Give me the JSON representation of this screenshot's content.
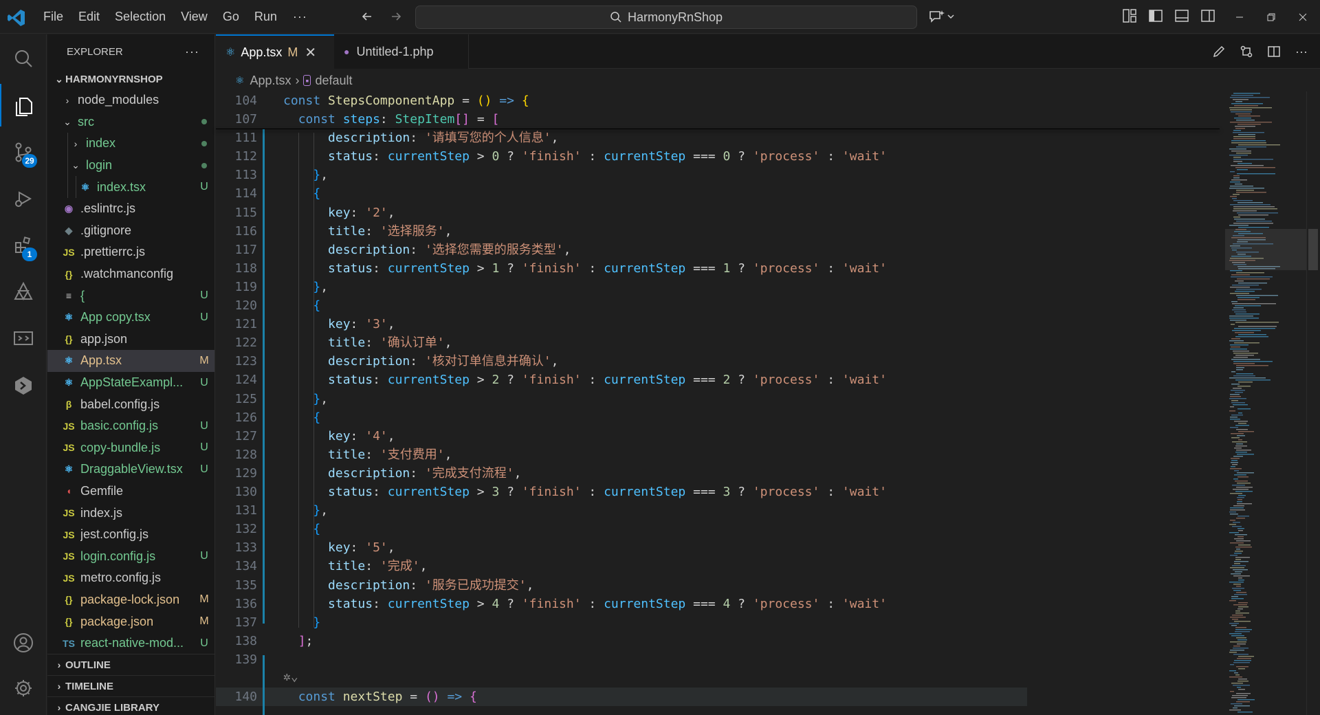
{
  "titlebar": {
    "menus": [
      "File",
      "Edit",
      "Selection",
      "View",
      "Go",
      "Run"
    ],
    "more": "···",
    "search_text": "HarmonyRnShop"
  },
  "activity": {
    "scm_badge": "29",
    "extensions_badge": "1"
  },
  "sidebar": {
    "title": "EXPLORER",
    "more": "···",
    "root": "HARMONYRNSHOP",
    "items": [
      {
        "name": "node_modules",
        "depth": 1,
        "kind": "folder",
        "open": false,
        "status": ""
      },
      {
        "name": "src",
        "depth": 1,
        "kind": "folder",
        "open": true,
        "status": "dot"
      },
      {
        "name": "index",
        "depth": 2,
        "kind": "folder",
        "open": false,
        "status": "dot"
      },
      {
        "name": "login",
        "depth": 2,
        "kind": "folder",
        "open": true,
        "status": "dot"
      },
      {
        "name": "index.tsx",
        "depth": 3,
        "kind": "react",
        "status": "U"
      },
      {
        "name": ".eslintrc.js",
        "depth": 1,
        "kind": "eslint",
        "status": ""
      },
      {
        "name": ".gitignore",
        "depth": 1,
        "kind": "git",
        "status": ""
      },
      {
        "name": ".prettierrc.js",
        "depth": 1,
        "kind": "js",
        "status": ""
      },
      {
        "name": ".watchmanconfig",
        "depth": 1,
        "kind": "json",
        "status": ""
      },
      {
        "name": "{",
        "depth": 1,
        "kind": "text",
        "status": "U"
      },
      {
        "name": "App copy.tsx",
        "depth": 1,
        "kind": "react",
        "status": "U"
      },
      {
        "name": "app.json",
        "depth": 1,
        "kind": "json",
        "status": ""
      },
      {
        "name": "App.tsx",
        "depth": 1,
        "kind": "react",
        "status": "M",
        "selected": true
      },
      {
        "name": "AppStateExampl...",
        "depth": 1,
        "kind": "react",
        "status": "U"
      },
      {
        "name": "babel.config.js",
        "depth": 1,
        "kind": "babel",
        "status": ""
      },
      {
        "name": "basic.config.js",
        "depth": 1,
        "kind": "js",
        "status": "U"
      },
      {
        "name": "copy-bundle.js",
        "depth": 1,
        "kind": "js",
        "status": "U"
      },
      {
        "name": "DraggableView.tsx",
        "depth": 1,
        "kind": "react",
        "status": "U"
      },
      {
        "name": "Gemfile",
        "depth": 1,
        "kind": "ruby",
        "status": ""
      },
      {
        "name": "index.js",
        "depth": 1,
        "kind": "js",
        "status": ""
      },
      {
        "name": "jest.config.js",
        "depth": 1,
        "kind": "js",
        "status": ""
      },
      {
        "name": "login.config.js",
        "depth": 1,
        "kind": "js",
        "status": "U"
      },
      {
        "name": "metro.config.js",
        "depth": 1,
        "kind": "js",
        "status": ""
      },
      {
        "name": "package-lock.json",
        "depth": 1,
        "kind": "json",
        "status": "M"
      },
      {
        "name": "package.json",
        "depth": 1,
        "kind": "json",
        "status": "M"
      },
      {
        "name": "react-native-mod...",
        "depth": 1,
        "kind": "ts",
        "status": "U"
      }
    ],
    "sections": [
      "OUTLINE",
      "TIMELINE",
      "CANGJIE LIBRARY"
    ]
  },
  "tabs": [
    {
      "label": "App.tsx",
      "status": "M",
      "active": true
    },
    {
      "label": "Untitled-1.php",
      "active": false
    }
  ],
  "breadcrumb": [
    "App.tsx",
    "default"
  ],
  "code": {
    "sticky": [
      {
        "n": "104",
        "tokens": [
          [
            "kw",
            "const "
          ],
          [
            "fn",
            "StepsComponentApp"
          ],
          [
            "pun",
            " = "
          ],
          [
            "br3",
            "()"
          ],
          [
            "kw",
            " => "
          ],
          [
            "br3",
            "{"
          ]
        ]
      },
      {
        "n": "107",
        "tokens": [
          [
            "pun",
            "  "
          ],
          [
            "kw",
            "const "
          ],
          [
            "var",
            "steps"
          ],
          [
            "pun",
            ": "
          ],
          [
            "type",
            "StepItem"
          ],
          [
            "br1",
            "[]"
          ],
          [
            "pun",
            " = "
          ],
          [
            "br1",
            "["
          ]
        ]
      }
    ],
    "lines": [
      {
        "n": "111",
        "tokens": [
          [
            "pun",
            "      "
          ],
          [
            "prop",
            "description"
          ],
          [
            "pun",
            ": "
          ],
          [
            "str",
            "'请填写您的个人信息'"
          ],
          [
            "pun",
            ","
          ]
        ]
      },
      {
        "n": "112",
        "tokens": [
          [
            "pun",
            "      "
          ],
          [
            "prop",
            "status"
          ],
          [
            "pun",
            ": "
          ],
          [
            "var",
            "currentStep"
          ],
          [
            "pun",
            " > "
          ],
          [
            "num",
            "0"
          ],
          [
            "pun",
            " ? "
          ],
          [
            "str",
            "'finish'"
          ],
          [
            "pun",
            " : "
          ],
          [
            "var",
            "currentStep"
          ],
          [
            "pun",
            " === "
          ],
          [
            "num",
            "0"
          ],
          [
            "pun",
            " ? "
          ],
          [
            "str",
            "'process'"
          ],
          [
            "pun",
            " : "
          ],
          [
            "str",
            "'wait'"
          ]
        ]
      },
      {
        "n": "113",
        "tokens": [
          [
            "pun",
            "    "
          ],
          [
            "br2",
            "}"
          ],
          [
            "pun",
            ","
          ]
        ]
      },
      {
        "n": "114",
        "tokens": [
          [
            "pun",
            "    "
          ],
          [
            "br2",
            "{"
          ]
        ]
      },
      {
        "n": "115",
        "tokens": [
          [
            "pun",
            "      "
          ],
          [
            "prop",
            "key"
          ],
          [
            "pun",
            ": "
          ],
          [
            "str",
            "'2'"
          ],
          [
            "pun",
            ","
          ]
        ]
      },
      {
        "n": "116",
        "tokens": [
          [
            "pun",
            "      "
          ],
          [
            "prop",
            "title"
          ],
          [
            "pun",
            ": "
          ],
          [
            "str",
            "'选择服务'"
          ],
          [
            "pun",
            ","
          ]
        ]
      },
      {
        "n": "117",
        "tokens": [
          [
            "pun",
            "      "
          ],
          [
            "prop",
            "description"
          ],
          [
            "pun",
            ": "
          ],
          [
            "str",
            "'选择您需要的服务类型'"
          ],
          [
            "pun",
            ","
          ]
        ]
      },
      {
        "n": "118",
        "tokens": [
          [
            "pun",
            "      "
          ],
          [
            "prop",
            "status"
          ],
          [
            "pun",
            ": "
          ],
          [
            "var",
            "currentStep"
          ],
          [
            "pun",
            " > "
          ],
          [
            "num",
            "1"
          ],
          [
            "pun",
            " ? "
          ],
          [
            "str",
            "'finish'"
          ],
          [
            "pun",
            " : "
          ],
          [
            "var",
            "currentStep"
          ],
          [
            "pun",
            " === "
          ],
          [
            "num",
            "1"
          ],
          [
            "pun",
            " ? "
          ],
          [
            "str",
            "'process'"
          ],
          [
            "pun",
            " : "
          ],
          [
            "str",
            "'wait'"
          ]
        ]
      },
      {
        "n": "119",
        "tokens": [
          [
            "pun",
            "    "
          ],
          [
            "br2",
            "}"
          ],
          [
            "pun",
            ","
          ]
        ]
      },
      {
        "n": "120",
        "tokens": [
          [
            "pun",
            "    "
          ],
          [
            "br2",
            "{"
          ]
        ]
      },
      {
        "n": "121",
        "tokens": [
          [
            "pun",
            "      "
          ],
          [
            "prop",
            "key"
          ],
          [
            "pun",
            ": "
          ],
          [
            "str",
            "'3'"
          ],
          [
            "pun",
            ","
          ]
        ]
      },
      {
        "n": "122",
        "tokens": [
          [
            "pun",
            "      "
          ],
          [
            "prop",
            "title"
          ],
          [
            "pun",
            ": "
          ],
          [
            "str",
            "'确认订单'"
          ],
          [
            "pun",
            ","
          ]
        ]
      },
      {
        "n": "123",
        "tokens": [
          [
            "pun",
            "      "
          ],
          [
            "prop",
            "description"
          ],
          [
            "pun",
            ": "
          ],
          [
            "str",
            "'核对订单信息并确认'"
          ],
          [
            "pun",
            ","
          ]
        ]
      },
      {
        "n": "124",
        "tokens": [
          [
            "pun",
            "      "
          ],
          [
            "prop",
            "status"
          ],
          [
            "pun",
            ": "
          ],
          [
            "var",
            "currentStep"
          ],
          [
            "pun",
            " > "
          ],
          [
            "num",
            "2"
          ],
          [
            "pun",
            " ? "
          ],
          [
            "str",
            "'finish'"
          ],
          [
            "pun",
            " : "
          ],
          [
            "var",
            "currentStep"
          ],
          [
            "pun",
            " === "
          ],
          [
            "num",
            "2"
          ],
          [
            "pun",
            " ? "
          ],
          [
            "str",
            "'process'"
          ],
          [
            "pun",
            " : "
          ],
          [
            "str",
            "'wait'"
          ]
        ]
      },
      {
        "n": "125",
        "tokens": [
          [
            "pun",
            "    "
          ],
          [
            "br2",
            "}"
          ],
          [
            "pun",
            ","
          ]
        ]
      },
      {
        "n": "126",
        "tokens": [
          [
            "pun",
            "    "
          ],
          [
            "br2",
            "{"
          ]
        ]
      },
      {
        "n": "127",
        "tokens": [
          [
            "pun",
            "      "
          ],
          [
            "prop",
            "key"
          ],
          [
            "pun",
            ": "
          ],
          [
            "str",
            "'4'"
          ],
          [
            "pun",
            ","
          ]
        ]
      },
      {
        "n": "128",
        "tokens": [
          [
            "pun",
            "      "
          ],
          [
            "prop",
            "title"
          ],
          [
            "pun",
            ": "
          ],
          [
            "str",
            "'支付费用'"
          ],
          [
            "pun",
            ","
          ]
        ]
      },
      {
        "n": "129",
        "tokens": [
          [
            "pun",
            "      "
          ],
          [
            "prop",
            "description"
          ],
          [
            "pun",
            ": "
          ],
          [
            "str",
            "'完成支付流程'"
          ],
          [
            "pun",
            ","
          ]
        ]
      },
      {
        "n": "130",
        "tokens": [
          [
            "pun",
            "      "
          ],
          [
            "prop",
            "status"
          ],
          [
            "pun",
            ": "
          ],
          [
            "var",
            "currentStep"
          ],
          [
            "pun",
            " > "
          ],
          [
            "num",
            "3"
          ],
          [
            "pun",
            " ? "
          ],
          [
            "str",
            "'finish'"
          ],
          [
            "pun",
            " : "
          ],
          [
            "var",
            "currentStep"
          ],
          [
            "pun",
            " === "
          ],
          [
            "num",
            "3"
          ],
          [
            "pun",
            " ? "
          ],
          [
            "str",
            "'process'"
          ],
          [
            "pun",
            " : "
          ],
          [
            "str",
            "'wait'"
          ]
        ]
      },
      {
        "n": "131",
        "tokens": [
          [
            "pun",
            "    "
          ],
          [
            "br2",
            "}"
          ],
          [
            "pun",
            ","
          ]
        ]
      },
      {
        "n": "132",
        "tokens": [
          [
            "pun",
            "    "
          ],
          [
            "br2",
            "{"
          ]
        ]
      },
      {
        "n": "133",
        "tokens": [
          [
            "pun",
            "      "
          ],
          [
            "prop",
            "key"
          ],
          [
            "pun",
            ": "
          ],
          [
            "str",
            "'5'"
          ],
          [
            "pun",
            ","
          ]
        ]
      },
      {
        "n": "134",
        "tokens": [
          [
            "pun",
            "      "
          ],
          [
            "prop",
            "title"
          ],
          [
            "pun",
            ": "
          ],
          [
            "str",
            "'完成'"
          ],
          [
            "pun",
            ","
          ]
        ]
      },
      {
        "n": "135",
        "tokens": [
          [
            "pun",
            "      "
          ],
          [
            "prop",
            "description"
          ],
          [
            "pun",
            ": "
          ],
          [
            "str",
            "'服务已成功提交'"
          ],
          [
            "pun",
            ","
          ]
        ]
      },
      {
        "n": "136",
        "tokens": [
          [
            "pun",
            "      "
          ],
          [
            "prop",
            "status"
          ],
          [
            "pun",
            ": "
          ],
          [
            "var",
            "currentStep"
          ],
          [
            "pun",
            " > "
          ],
          [
            "num",
            "4"
          ],
          [
            "pun",
            " ? "
          ],
          [
            "str",
            "'finish'"
          ],
          [
            "pun",
            " : "
          ],
          [
            "var",
            "currentStep"
          ],
          [
            "pun",
            " === "
          ],
          [
            "num",
            "4"
          ],
          [
            "pun",
            " ? "
          ],
          [
            "str",
            "'process'"
          ],
          [
            "pun",
            " : "
          ],
          [
            "str",
            "'wait'"
          ]
        ]
      },
      {
        "n": "137",
        "tokens": [
          [
            "pun",
            "    "
          ],
          [
            "br2",
            "}"
          ]
        ]
      },
      {
        "n": "138",
        "tokens": [
          [
            "pun",
            "  "
          ],
          [
            "br1",
            "]"
          ],
          [
            "pun",
            ";"
          ]
        ]
      },
      {
        "n": "139",
        "tokens": []
      },
      {
        "n": "",
        "tokens": []
      },
      {
        "n": "140",
        "tokens": [
          [
            "pun",
            "  "
          ],
          [
            "kw",
            "const "
          ],
          [
            "fn",
            "nextStep"
          ],
          [
            "pun",
            " = "
          ],
          [
            "br1",
            "()"
          ],
          [
            "kw",
            " => "
          ],
          [
            "br1",
            "{"
          ]
        ]
      }
    ]
  },
  "colors": {
    "accent": "#0078d4",
    "untracked": "#73c991",
    "modified": "#e2c08d"
  }
}
